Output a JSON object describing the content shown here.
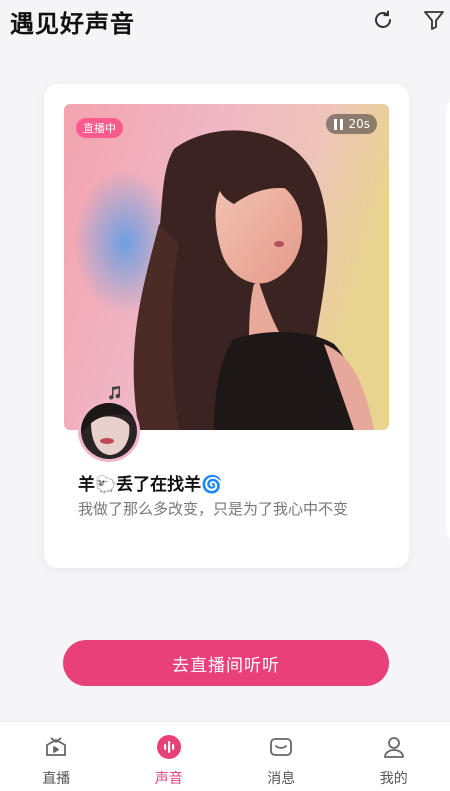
{
  "header": {
    "title": "遇见好声音",
    "refresh_icon": "refresh-icon",
    "filter_icon": "filter-icon"
  },
  "card": {
    "live_badge": "直播中",
    "duration": "20s",
    "username": "羊🐑丢了在找羊🌀",
    "description": "我做了那么多改变，只是为了我心中不变"
  },
  "cta": {
    "label": "去直播间听听"
  },
  "tabs": [
    {
      "label": "直播",
      "icon": "live-tv-icon",
      "active": false
    },
    {
      "label": "声音",
      "icon": "voice-icon",
      "active": true
    },
    {
      "label": "消息",
      "icon": "message-icon",
      "active": false
    },
    {
      "label": "我的",
      "icon": "profile-icon",
      "active": false
    }
  ],
  "colors": {
    "accent": "#e9407a",
    "live_badge": "#ff5a8c",
    "background": "#f5f5f7"
  }
}
